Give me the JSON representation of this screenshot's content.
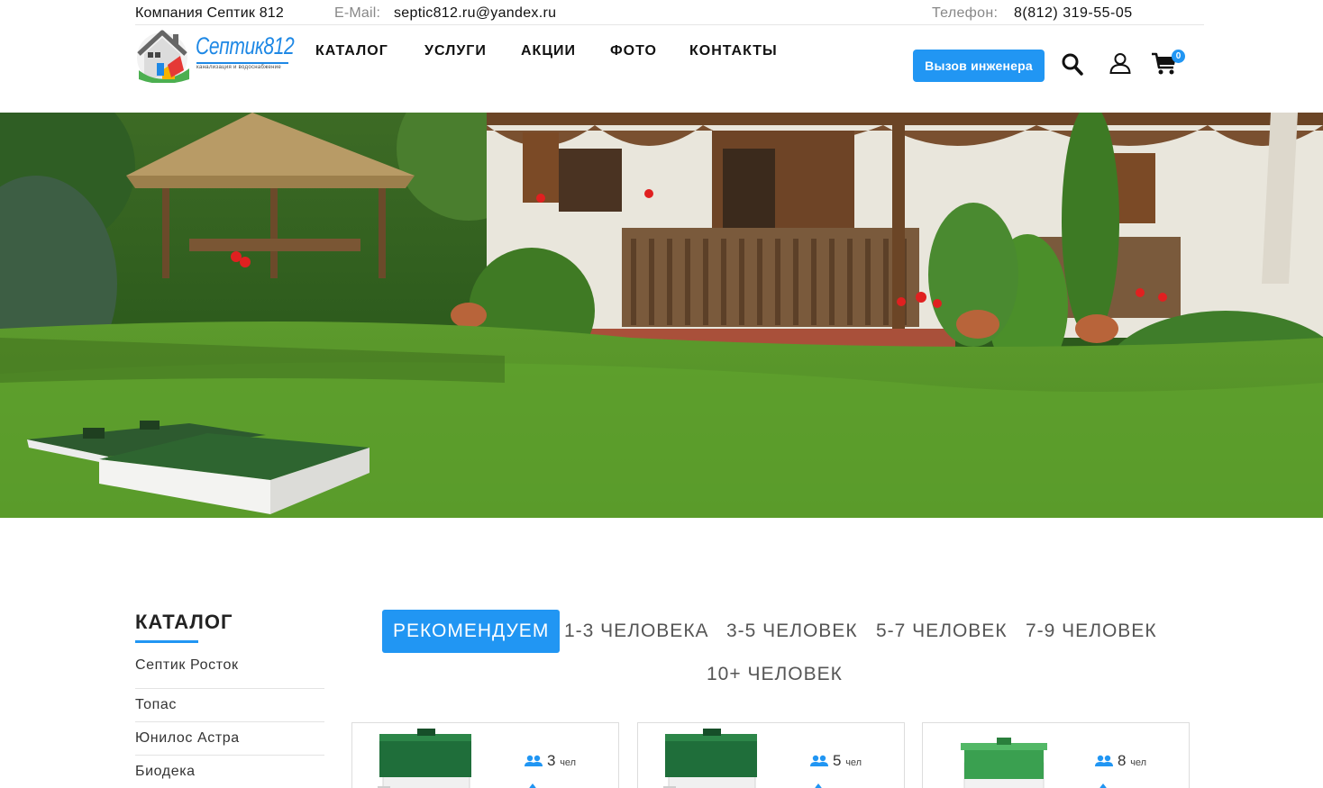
{
  "topbar": {
    "company": "Компания Септик 812",
    "email_label": "E-Mail:",
    "email": "septic812.ru@yandex.ru",
    "phone_label": "Телефон:",
    "phone": "8(812) 319-55-05"
  },
  "logo": {
    "title": "Септик812",
    "subtitle": "канализация и водоснабжение"
  },
  "nav": [
    "КАТАЛОГ",
    "УСЛУГИ",
    "АКЦИИ",
    "ФОТО",
    "КОНТАКТЫ"
  ],
  "header": {
    "engineer_button": "Вызов инженера",
    "cart_count": "0"
  },
  "sidebar": {
    "title": "КАТАЛОГ",
    "items": [
      "Септик Росток",
      "Топас",
      "Юнилос Астра",
      "Биодека"
    ]
  },
  "tabs": {
    "active": "РЕКОМЕНДУЕМ",
    "items": [
      "РЕКОМЕНДУЕМ",
      "1-3 ЧЕЛОВЕКА",
      "3-5 ЧЕЛОВЕК",
      "5-7 ЧЕЛОВЕК",
      "7-9 ЧЕЛОВЕК",
      "10+ ЧЕЛОВЕК"
    ]
  },
  "products": [
    {
      "people": "3",
      "unit": "чел"
    },
    {
      "people": "5",
      "unit": "чел"
    },
    {
      "people": "8",
      "unit": "чел"
    }
  ],
  "colors": {
    "accent": "#2196f3",
    "text": "#222222",
    "muted": "#888888"
  }
}
